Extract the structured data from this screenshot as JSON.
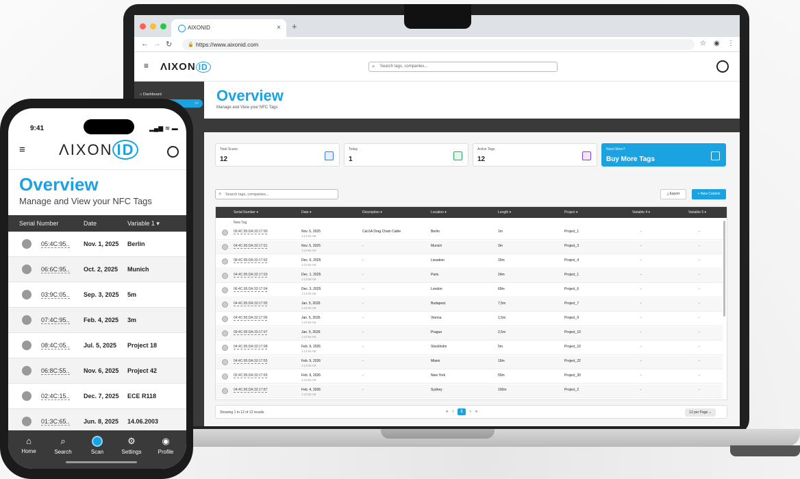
{
  "browser": {
    "tab_title": "AIXONID",
    "url": "https://www.aixonid.com",
    "new_tab": "+",
    "close": "×"
  },
  "app": {
    "logo_text": "ΛIXON",
    "logo_id": "ID",
    "search_placeholder": "Search tags, companies...",
    "sidebar": {
      "items": [
        "Dashboard",
        ">>"
      ]
    },
    "overview_title": "Overview",
    "overview_subtitle": "Manage and View your NFC Tags",
    "cards": [
      {
        "label": "Total Scans",
        "value": "12"
      },
      {
        "label": "Today",
        "value": "1"
      },
      {
        "label": "Active Tags",
        "value": "12"
      },
      {
        "label": "Need More?",
        "value": "Buy More Tags"
      }
    ],
    "content_search_placeholder": "Search tags, companies...",
    "export_label": "Export",
    "new_column_label": "+ New Column",
    "table": {
      "headers": [
        "Serial Number ▾",
        "Date ▾",
        "Description ▾",
        "Location ▾",
        "Length ▾",
        "Project ▾",
        "Variable 4 ▾",
        "Variable 5 ▾"
      ],
      "new_tag_label": "New Tag",
      "rows": [
        [
          "09:4C:95:DA:33:17:90",
          "Nov. 5, 2025",
          "1:13:56 AM",
          "Cat.6A Drag Chain Cable",
          "Berlin",
          "1m",
          "Project_1",
          "-",
          "-"
        ],
        [
          "04:4C:95:DA:33:17:91",
          "Nov. 5, 2025",
          "1:13:56 AM",
          "-",
          "Munich",
          "3m",
          "Project_3",
          "-",
          "-"
        ],
        [
          "08:4C:95:DA:33:17:92",
          "Dec. 6, 2025",
          "1:13:56 AM",
          "-",
          "Lissabon",
          "15m",
          "Project_4",
          "-",
          "-"
        ],
        [
          "04:4C:95:DA:33:17:93",
          "Dec. 1, 2025",
          "1:13:56 AM",
          "-",
          "Paris",
          "24m",
          "Project_1",
          "-",
          "-"
        ],
        [
          "06:4C:95:DA:33:17:94",
          "Dec. 3, 2025",
          "1:13:56 AM",
          "-",
          "London",
          "69m",
          "Project_6",
          "-",
          "-"
        ],
        [
          "04:4C:95:DA:33:17:95",
          "Jan. 5, 2026",
          "1:13:56 AM",
          "-",
          "Budapest",
          "7,5m",
          "Project_7",
          "-",
          "-"
        ],
        [
          "04:4C:95:DA:33:17:96",
          "Jan. 5, 2026",
          "1:13:56 AM",
          "-",
          "Vienna",
          "1,5m",
          "Project_9",
          "-",
          "-"
        ],
        [
          "09:4C:95:DA:33:17:97",
          "Jan. 5, 2026",
          "1:13:56 AM",
          "-",
          "Prague",
          "2,5m",
          "Project_10",
          "-",
          "-"
        ],
        [
          "04:4C:95:DA:33:17:98",
          "Feb. 9, 2026",
          "1:13:56 AM",
          "-",
          "Stockholm",
          "5m",
          "Project_10",
          "-",
          "-"
        ],
        [
          "04:4C:95:DA:33:17:55",
          "Feb. 9, 2026",
          "1:13:56 AM",
          "-",
          "Miami",
          "16m",
          "Project_22",
          "-",
          "-"
        ],
        [
          "02:4C:95:DA:33:17:65",
          "Feb. 9, 2026",
          "1:13:56 AM",
          "-",
          "New York",
          "50m",
          "Project_30",
          "-",
          "-"
        ],
        [
          "04:4C:95:DA:33:17:87",
          "Feb. 4, 2026",
          "1:13:56 AM",
          "-",
          "Sydney",
          "100m",
          "Project_2",
          "-",
          "-"
        ]
      ]
    },
    "pager": {
      "info": "Showing 1 to 12 of 12 results",
      "first": "«",
      "prev": "‹",
      "page": "1",
      "next": "›",
      "last": "»",
      "per_page": "12 per Page ⌄"
    }
  },
  "phone": {
    "time": "9:41",
    "status": "▂▄▆ ≋ ▬",
    "logo_text": "ΛIXON",
    "logo_id": "ID",
    "title": "Overview",
    "subtitle": "Manage and View your NFC Tags",
    "headers": [
      "Serial Number",
      "Date",
      "Variable 1 ▾"
    ],
    "rows": [
      [
        "05:4C:95..",
        "Nov. 1, 2025",
        "Berlin"
      ],
      [
        "06:6C:95..",
        "Oct. 2, 2025",
        "Munich"
      ],
      [
        "03:9C:05..",
        "Sep. 3, 2025",
        "5m"
      ],
      [
        "07:4C:95..",
        "Feb. 4, 2025",
        "3m"
      ],
      [
        "08:4C:05..",
        "Jul. 5, 2025",
        "Project 18"
      ],
      [
        "06:8C:55..",
        "Nov. 6, 2025",
        "Project 42"
      ],
      [
        "02:4C:15..",
        "Dec. 7, 2025",
        "ECE R118"
      ],
      [
        "01:3C:65..",
        "Jun. 8, 2025",
        "14.06.2003"
      ]
    ],
    "nav": [
      "Home",
      "Search",
      "Scan",
      "Settings",
      "Profile"
    ]
  }
}
